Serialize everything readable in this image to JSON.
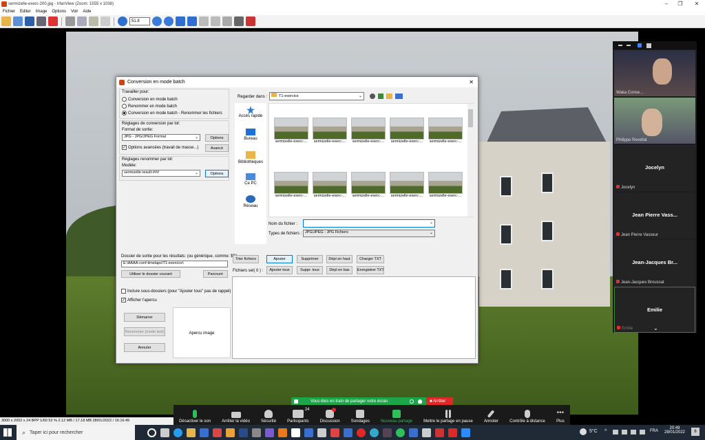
{
  "window": {
    "title": "sermizelle-exerc-200.jpg - IrfanView (Zoom: 1555 x 1038)"
  },
  "menu": [
    "Fichier",
    "Editer",
    "Image",
    "Options",
    "Voir",
    "Aide"
  ],
  "toolbar": {
    "zoom": "51.8"
  },
  "dialog": {
    "title": "Conversion en mode batch",
    "travailler": "Travailler pour:",
    "modes": [
      "Conversion en mode batch",
      "Renommer en mode batch",
      "Conversion en mode batch - Renommer les fichiers"
    ],
    "reglages_conv": "Réglages de conversion par lot:",
    "format_label": "Format de sortie:",
    "format_value": "JPG - JPG/JPEG Format",
    "options": "Options",
    "options_avancees": "Options avancées (travail de masse...)",
    "avance": "Avancé",
    "reglages_ren": "Réglages renommer par lot:",
    "modele_label": "Modèle:",
    "modele_value": "sermizelle-result-###",
    "options2": "Options",
    "dossier_label": "Dossier de sortie pour les résultats: (ou générique, comme: $D)",
    "dossier_value": "E:\\AAAA-conf-timelaps\\T1-exercice\\",
    "utiliser": "Utiliser le dossier courant",
    "parcourir": "Parcourir",
    "inclure": "Inclure sous-dossiers (pour \"Ajouter tous\" pas de rappel)",
    "afficher": "Afficher l'apercu",
    "demarrer": "Démarrer",
    "renommer": "Renommer (mode test)",
    "annuler": "Annuler",
    "apercu": "Apercu image",
    "regarder_label": "Regarder dans :",
    "regarder_value": "T1-exercice",
    "nav": [
      "Accès rapide",
      "Bureau",
      "Bibliothèques",
      "Ce PC",
      "Réseau"
    ],
    "thumbs": [
      "sermizelle-exerc-...",
      "sermizelle-exerc-...",
      "sermizelle-exerc-...",
      "sermizelle-exerc-...",
      "sermizelle-exerc-...",
      "sermizelle-exerc-...",
      "sermizelle-exerc-...",
      "sermizelle-exerc-...",
      "sermizelle-exerc-...",
      "sermizelle-exerc-..."
    ],
    "nom_label": "Nom du fichier :",
    "nom_value": "",
    "types_label": "Types de fichiers :",
    "types_value": "JPG/JPEG - JPG Fichiers",
    "trier": "Trier fichiers",
    "ajouter": "Ajouter",
    "supprimer": "Supprimer",
    "depl_haut": "Dépl en haut",
    "charger": "Charger TXT",
    "fichiers_sel": "Fichiers sel( 0 ) :",
    "ajouter_tous": "Ajouter tous",
    "suppr_tous": "Suppr. tous",
    "depl_bas": "Dépl en bas",
    "enregistrer": "Enregistrer TXT"
  },
  "zoom": {
    "participants": [
      {
        "name": "Waka Conse...",
        "video": true
      },
      {
        "name": "Philippe Revellat",
        "video": true
      },
      {
        "name": "Jocelyn",
        "tag": "Jocelyn"
      },
      {
        "name": "Jean Pierre Vass...",
        "tag": "Jean Pierre Vasseur"
      },
      {
        "name": "Jean-Jacques Br...",
        "tag": "Jean-Jacques Broussat"
      },
      {
        "name": "Emilie",
        "tag": "Emilie"
      }
    ],
    "share_text": "Vous êtes en train de partager votre écran",
    "stop": "Arrêter",
    "controls": [
      {
        "label": "Désactiver le son",
        "icon": "mic-icon"
      },
      {
        "label": "Arrêter la vidéo",
        "icon": "video-icon"
      },
      {
        "label": "Sécurité",
        "icon": "shield-icon"
      },
      {
        "label": "Participants",
        "icon": "participants-icon",
        "badge": "24"
      },
      {
        "label": "Discussion",
        "icon": "chat-icon"
      },
      {
        "label": "Sondages",
        "icon": "poll-icon"
      },
      {
        "label": "Nouveau partage",
        "icon": "share-icon"
      },
      {
        "label": "Mettre le partage en pause",
        "icon": "pause-icon"
      },
      {
        "label": "Annoter",
        "icon": "pen-icon"
      },
      {
        "label": "Contrôle à distance",
        "icon": "mouse-icon"
      },
      {
        "label": "Plus",
        "icon": "more-icon"
      }
    ]
  },
  "status": {
    "text": "3000 x 2002 x 24 BPP    1/60    52 %    2.12 MB / 17.18 MB    28/01/2022 / 16:16:49"
  },
  "taskbar": {
    "search": "Taper ici pour rechercher",
    "weather": "5°C",
    "lang": "FRA",
    "time": "20:49",
    "date": "28/01/2022",
    "notif": "6"
  }
}
